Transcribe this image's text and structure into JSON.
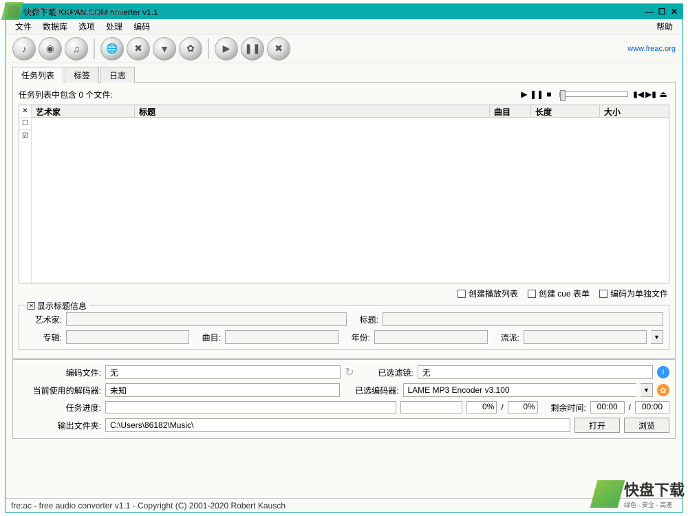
{
  "titlebar": {
    "title": "快盘下载 KKPAN.COM  onverter v1.1"
  },
  "menu": {
    "file": "文件",
    "database": "数据库",
    "options": "选项",
    "process": "处理",
    "encode": "编码",
    "help": "帮助"
  },
  "toolbar_link": "www.freac.org",
  "tabs": {
    "joblist": "任务列表",
    "tags": "标签",
    "log": "日志"
  },
  "joblist": {
    "count_label": "任务列表中包含 0 个文件:",
    "columns": {
      "artist": "艺术家",
      "title": "标题",
      "track": "曲目",
      "length": "长度",
      "size": "大小"
    }
  },
  "options": {
    "create_playlist": "创建播放列表",
    "create_cue": "创建 cue 表单",
    "encode_single": "编码为单独文件"
  },
  "tag_group": {
    "title": "显示标题信息",
    "artist": "艺术家:",
    "title_lbl": "标题:",
    "album": "专辑:",
    "track": "曲目:",
    "year": "年份:",
    "genre": "流派:"
  },
  "encoder": {
    "encode_file_lbl": "编码文件:",
    "encode_file_val": "无",
    "filters_lbl": "已选滤镜:",
    "filters_val": "无",
    "decoder_lbl": "当前使用的解码器:",
    "decoder_val": "未知",
    "encoder_lbl": "已选编码器:",
    "encoder_val": "LAME MP3 Encoder v3.100",
    "progress_lbl": "任务进度:",
    "pct1": "0%",
    "pct2": "0%",
    "remaining_lbl": "剩余时间:",
    "time1": "00:00",
    "time2": "00:00",
    "output_lbl": "输出文件夹:",
    "output_val": "C:\\Users\\86182\\Music\\",
    "open_btn": "打开",
    "browse_btn": "浏览"
  },
  "statusbar": "fre:ac - free audio converter v1.1 - Copyright (C) 2001-2020 Robert Kausch",
  "watermark": {
    "tl": "快盘下载 KKPAN.COM",
    "br_main": "快盘下载",
    "br_sub": "绿色 · 安全 · 高速"
  }
}
